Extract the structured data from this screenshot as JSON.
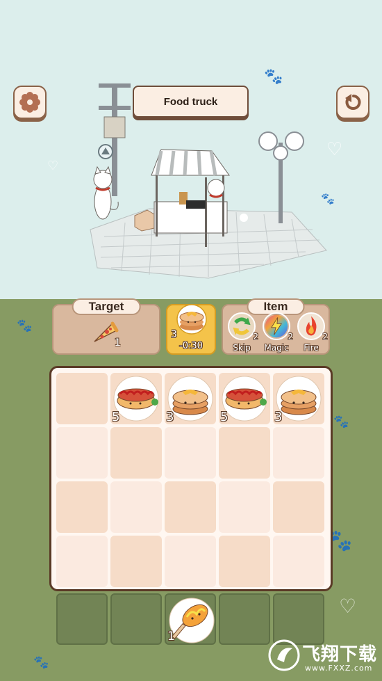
{
  "scene": {
    "title": "Food truck",
    "settings_icon": "gear-icon",
    "undo_icon": "undo-icon"
  },
  "target": {
    "header": "Target",
    "item_icon": "pizza-slice-icon",
    "count": "1"
  },
  "timer": {
    "item_icon": "pancake-stack-icon",
    "count": "3",
    "time": "-0:30"
  },
  "items": {
    "header": "Item",
    "list": [
      {
        "label": "Skip",
        "count": "2",
        "icon": "skip-arrows-icon"
      },
      {
        "label": "Magic",
        "count": "2",
        "icon": "magic-lightning-icon"
      },
      {
        "label": "Fire",
        "count": "2",
        "icon": "fire-icon"
      }
    ]
  },
  "board": {
    "row1": [
      {
        "food": "",
        "count": ""
      },
      {
        "food": "hotdog",
        "count": "5"
      },
      {
        "food": "pancake",
        "count": "3"
      },
      {
        "food": "hotdog",
        "count": "5"
      },
      {
        "food": "pancake",
        "count": "3"
      }
    ]
  },
  "tray": [
    {
      "food": "",
      "count": ""
    },
    {
      "food": "",
      "count": ""
    },
    {
      "food": "corndog",
      "count": "1"
    },
    {
      "food": "",
      "count": ""
    },
    {
      "food": "",
      "count": ""
    }
  ],
  "watermark": {
    "title": "飞翔下载",
    "url": "www.FXXZ.com"
  },
  "colors": {
    "sky": "#dceeec",
    "grass": "#879b63",
    "panel": "#d9b89e",
    "timer": "#f4c34a",
    "border": "#5a3a26"
  }
}
